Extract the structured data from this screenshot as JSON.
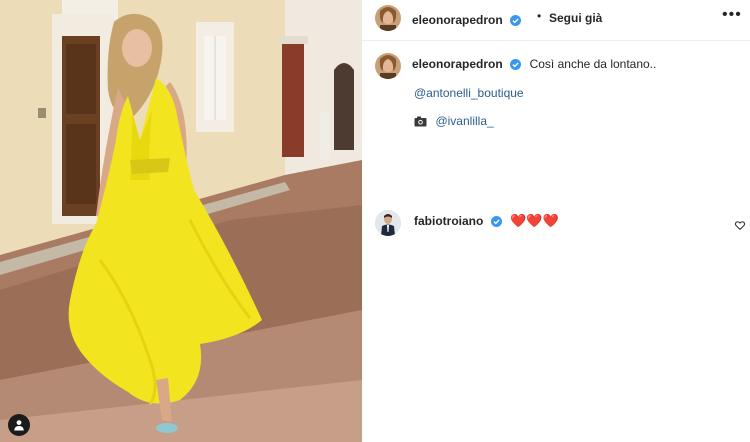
{
  "post": {
    "author": "eleonorapedron",
    "separator": "•",
    "follow_label": "Segui già",
    "more_label": "•••",
    "caption": "Così anche da lontano..",
    "mention_brand": "@antonelli_boutique",
    "camera_icon": "camera-icon",
    "mention_photographer": "@ivanlilla_"
  },
  "comments": [
    {
      "user": "fabiotroiano",
      "text": "❤️❤️❤️"
    }
  ],
  "colors": {
    "link": "#2b5d8f",
    "verified": "#3897f0",
    "heart": "#cc1d2b",
    "dress": "#f2e51f"
  }
}
